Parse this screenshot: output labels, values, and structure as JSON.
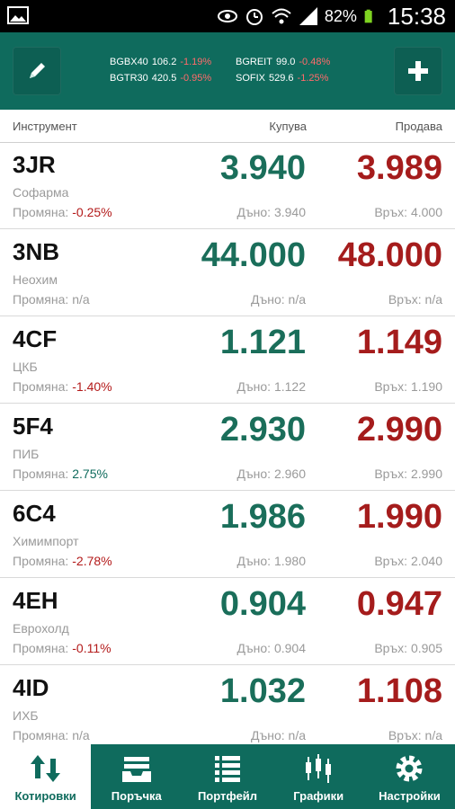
{
  "status": {
    "battery": "82%",
    "time": "15:38"
  },
  "ticker": [
    [
      {
        "name": "BGBX40",
        "value": "106.2",
        "change": "-1.19%"
      },
      {
        "name": "BGREIT",
        "value": "99.0",
        "change": "-0.48%"
      }
    ],
    [
      {
        "name": "BGTR30",
        "value": "420.5",
        "change": "-0.95%"
      },
      {
        "name": "SOFIX",
        "value": "529.6",
        "change": "-1.25%"
      }
    ]
  ],
  "columns": {
    "instrument": "Инструмент",
    "buy": "Купува",
    "sell": "Продава"
  },
  "instruments": [
    {
      "symbol": "3JR",
      "name": "Софарма",
      "change_label": "Промяна:",
      "change": "-0.25%",
      "dir": "neg",
      "buy": "3.940",
      "sell": "3.989",
      "low": "Дъно: 3.940",
      "high": "Връх: 4.000"
    },
    {
      "symbol": "3NB",
      "name": "Неохим",
      "change_label": "Промяна:",
      "change": "n/a",
      "dir": "na",
      "buy": "44.000",
      "sell": "48.000",
      "low": "Дъно: n/a",
      "high": "Връх: n/a"
    },
    {
      "symbol": "4CF",
      "name": "ЦКБ",
      "change_label": "Промяна:",
      "change": "-1.40%",
      "dir": "neg",
      "buy": "1.121",
      "sell": "1.149",
      "low": "Дъно: 1.122",
      "high": "Връх: 1.190"
    },
    {
      "symbol": "5F4",
      "name": "ПИБ",
      "change_label": "Промяна:",
      "change": "2.75%",
      "dir": "pos",
      "buy": "2.930",
      "sell": "2.990",
      "low": "Дъно: 2.960",
      "high": "Връх: 2.990"
    },
    {
      "symbol": "6C4",
      "name": "Химимпорт",
      "change_label": "Промяна:",
      "change": "-2.78%",
      "dir": "neg",
      "buy": "1.986",
      "sell": "1.990",
      "low": "Дъно: 1.980",
      "high": "Връх: 2.040"
    },
    {
      "symbol": "4EH",
      "name": "Еврохолд",
      "change_label": "Промяна:",
      "change": "-0.11%",
      "dir": "neg",
      "buy": "0.904",
      "sell": "0.947",
      "low": "Дъно: 0.904",
      "high": "Връх: 0.905"
    },
    {
      "symbol": "4ID",
      "name": "ИХБ",
      "change_label": "Промяна:",
      "change": "n/a",
      "dir": "na",
      "buy": "1.032",
      "sell": "1.108",
      "low": "Дъно: n/a",
      "high": "Връх: n/a"
    }
  ],
  "nav": [
    {
      "label": "Котировки",
      "icon": "quotes-icon",
      "active": true
    },
    {
      "label": "Поръчка",
      "icon": "inbox-icon",
      "active": false
    },
    {
      "label": "Портфейл",
      "icon": "list-icon",
      "active": false
    },
    {
      "label": "Графики",
      "icon": "candlestick-icon",
      "active": false
    },
    {
      "label": "Настройки",
      "icon": "gear-icon",
      "active": false
    }
  ],
  "colors": {
    "accent": "#0f6b5d",
    "buy": "#1a6e5a",
    "sell": "#a51c1c",
    "negative": "#b31a1a",
    "positive": "#0f6b5d"
  }
}
